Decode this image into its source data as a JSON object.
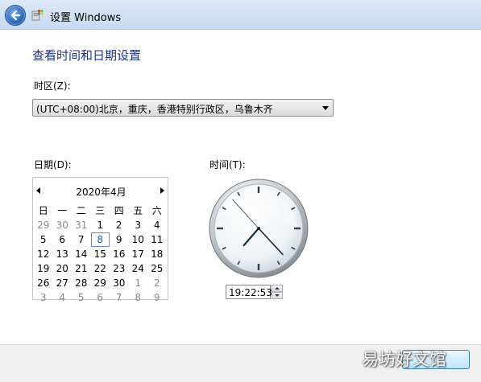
{
  "window": {
    "title": "设置 Windows"
  },
  "heading": "查看时间和日期设置",
  "timezone": {
    "label": "时区(Z):",
    "value": "(UTC+08:00)北京，重庆，香港特别行政区，乌鲁木齐"
  },
  "date": {
    "label": "日期(D):",
    "month_title": "2020年4月",
    "weekdays": [
      "日",
      "一",
      "二",
      "三",
      "四",
      "五",
      "六"
    ],
    "weeks": [
      [
        {
          "d": "29",
          "o": true
        },
        {
          "d": "30",
          "o": true
        },
        {
          "d": "31",
          "o": true
        },
        {
          "d": "1"
        },
        {
          "d": "2"
        },
        {
          "d": "3"
        },
        {
          "d": "4"
        }
      ],
      [
        {
          "d": "5"
        },
        {
          "d": "6"
        },
        {
          "d": "7"
        },
        {
          "d": "8",
          "sel": true
        },
        {
          "d": "9"
        },
        {
          "d": "10"
        },
        {
          "d": "11"
        }
      ],
      [
        {
          "d": "12"
        },
        {
          "d": "13"
        },
        {
          "d": "14"
        },
        {
          "d": "15"
        },
        {
          "d": "16"
        },
        {
          "d": "17"
        },
        {
          "d": "18"
        }
      ],
      [
        {
          "d": "19"
        },
        {
          "d": "20"
        },
        {
          "d": "21"
        },
        {
          "d": "22"
        },
        {
          "d": "23"
        },
        {
          "d": "24"
        },
        {
          "d": "25"
        }
      ],
      [
        {
          "d": "26"
        },
        {
          "d": "27"
        },
        {
          "d": "28"
        },
        {
          "d": "29"
        },
        {
          "d": "30"
        },
        {
          "d": "1",
          "o": true
        },
        {
          "d": "2",
          "o": true
        }
      ],
      [
        {
          "d": "3",
          "o": true
        },
        {
          "d": "4",
          "o": true
        },
        {
          "d": "5",
          "o": true
        },
        {
          "d": "6",
          "o": true
        },
        {
          "d": "7",
          "o": true
        },
        {
          "d": "8",
          "o": true
        },
        {
          "d": "9",
          "o": true
        }
      ]
    ]
  },
  "time": {
    "label": "时间(T):",
    "value": "19:22:53",
    "hour": 19,
    "minute": 22,
    "second": 53
  },
  "watermark": "易坊好文馆",
  "icons": {
    "back": "back-arrow-icon",
    "app": "windows-setup-icon"
  },
  "colors": {
    "heading": "#1e3287",
    "accent": "#2a5ea8"
  }
}
